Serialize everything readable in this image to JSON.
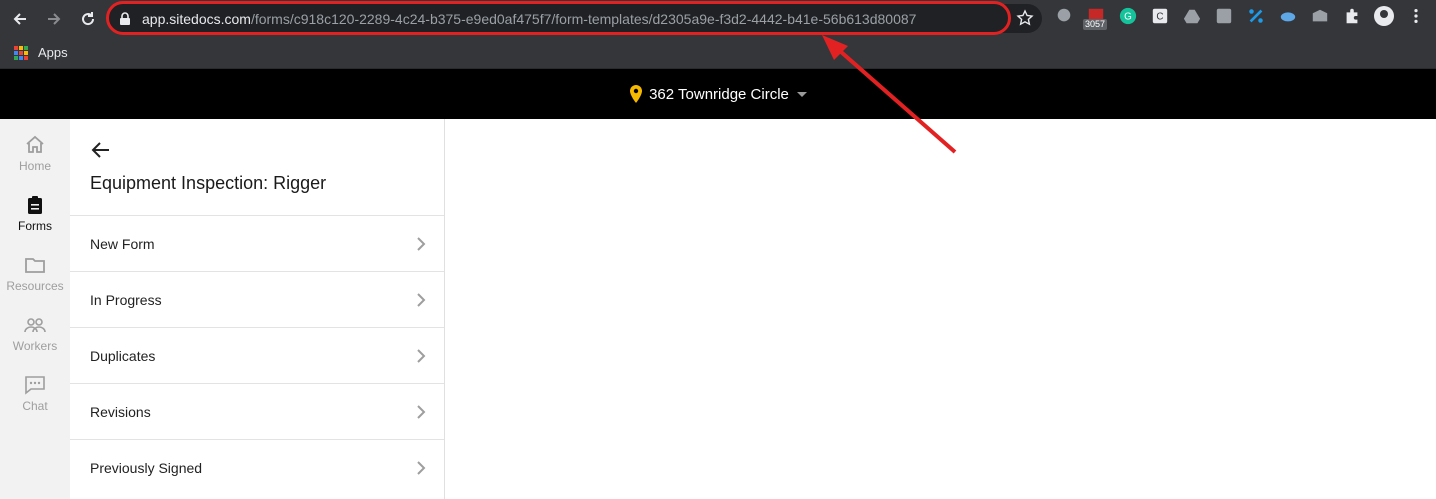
{
  "browser": {
    "url_host": "app.sitedocs.com",
    "url_path": "/forms/c918c120-2289-4c24-b375-e9ed0af475f7/form-templates/d2305a9e-f3d2-4442-b41e-56b613d80087",
    "extension_badge": "3057",
    "bookmarks": {
      "apps_label": "Apps"
    }
  },
  "header": {
    "location": "362 Townridge Circle"
  },
  "rail": {
    "items": [
      {
        "label": "Home",
        "icon": "home-icon"
      },
      {
        "label": "Forms",
        "icon": "clipboard-icon"
      },
      {
        "label": "Resources",
        "icon": "folder-icon"
      },
      {
        "label": "Workers",
        "icon": "workers-icon"
      },
      {
        "label": "Chat",
        "icon": "chat-icon"
      }
    ]
  },
  "panel": {
    "title": "Equipment Inspection: Rigger",
    "items": [
      {
        "label": "New Form"
      },
      {
        "label": "In Progress"
      },
      {
        "label": "Duplicates"
      },
      {
        "label": "Revisions"
      },
      {
        "label": "Previously Signed"
      }
    ]
  },
  "colors": {
    "accent_pin": "#f5b800",
    "annotation": "#e22222",
    "header_bg": "#000000"
  }
}
